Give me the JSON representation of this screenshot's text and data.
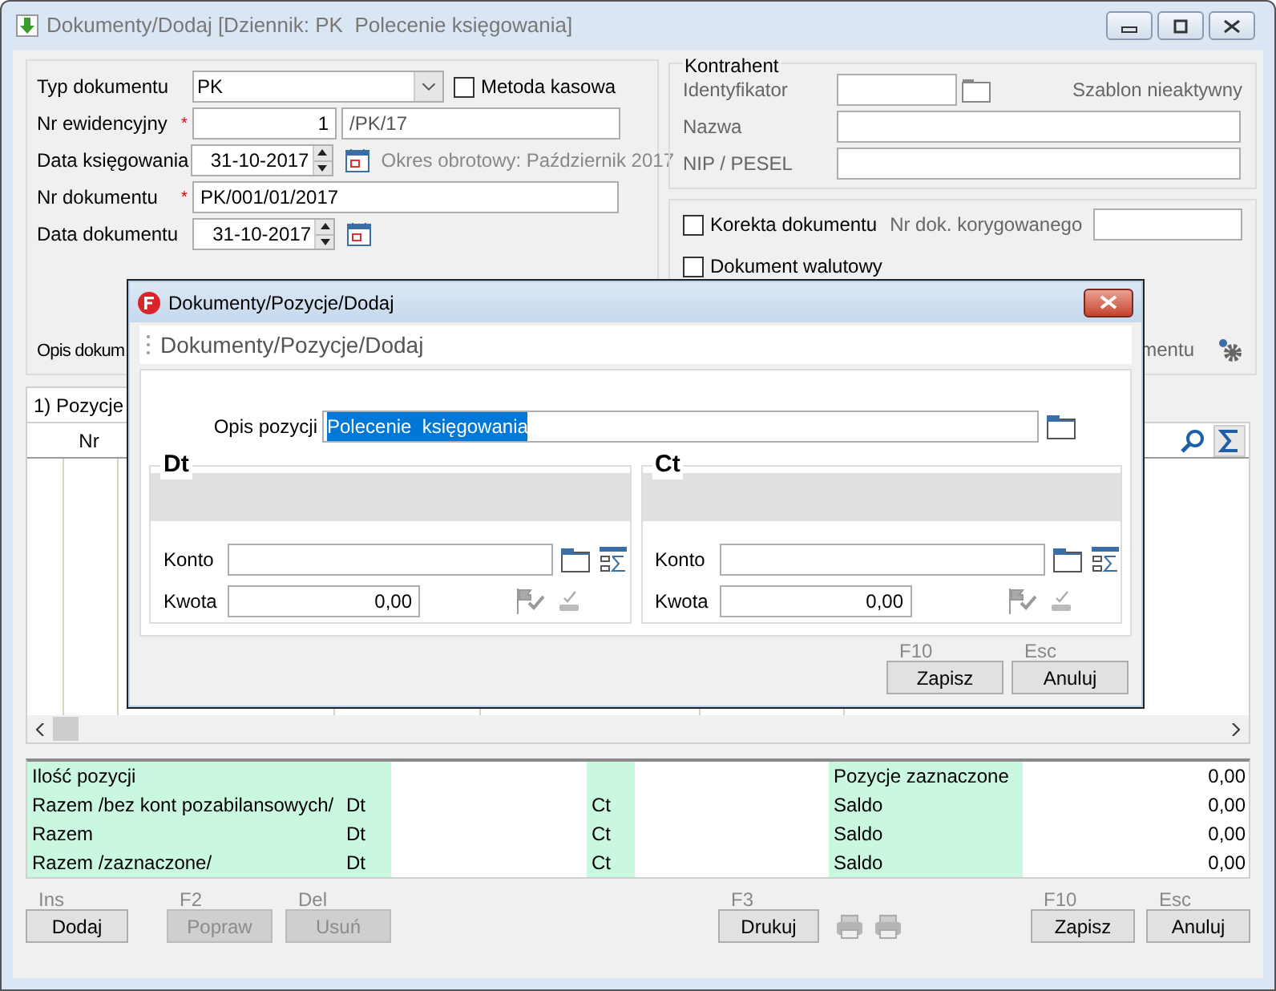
{
  "window": {
    "title": "Dokumenty/Dodaj [Dziennik: PK  Polecenie księgowania]"
  },
  "document": {
    "typ": {
      "label": "Typ dokumentu",
      "value": "PK"
    },
    "metoda_kasowa": {
      "label": "Metoda kasowa",
      "checked": false
    },
    "nr_ewidencyjny": {
      "label": "Nr ewidencyjny",
      "required_mark": "*",
      "number": "1",
      "suffix": "/PK/17"
    },
    "data_ksiegowania": {
      "label": "Data księgowania",
      "value": "31-10-2017",
      "note": "Okres obrotowy: Październik 2017"
    },
    "nr_dokumentu": {
      "label": "Nr dokumentu",
      "required_mark": "*",
      "value": "PK/001/01/2017"
    },
    "data_dokumentu": {
      "label": "Data dokumentu",
      "value": "31-10-2017"
    },
    "opis_label": "Opis dokum"
  },
  "kontrahent": {
    "title": "Kontrahent",
    "identyfikator_label": "Identyfikator",
    "template_status": "Szablon nieaktywny",
    "nazwa_label": "Nazwa",
    "nip_label": "NIP / PESEL"
  },
  "options": {
    "korekta": {
      "label": "Korekta dokumentu",
      "checked": false
    },
    "nr_korygowanego_label": "Nr dok. korygowanego",
    "walutowy": {
      "label": "Dokument walutowy",
      "checked": false
    },
    "partial_label": "mentu"
  },
  "tabs": [
    {
      "label": "1) Pozycje",
      "selected": true
    }
  ],
  "grid": {
    "columns": [
      "Nr"
    ]
  },
  "summary": [
    {
      "label": "Ilość pozycji",
      "right_label": "Pozycje zaznaczone",
      "value": "0,00"
    },
    {
      "label": "Razem /bez kont pozabilansowych/",
      "dt": "Dt",
      "ct": "Ct",
      "right_label": "Saldo",
      "value": "0,00"
    },
    {
      "label": "Razem",
      "dt": "Dt",
      "ct": "Ct",
      "right_label": "Saldo",
      "value": "0,00"
    },
    {
      "label": "Razem /zaznaczone/",
      "dt": "Dt",
      "ct": "Ct",
      "right_label": "Saldo",
      "value": "0,00"
    }
  ],
  "buttons_left": [
    {
      "key": "Ins",
      "label": "Dodaj",
      "disabled": false
    },
    {
      "key": "F2",
      "label": "Popraw",
      "disabled": true
    },
    {
      "key": "Del",
      "label": "Usuń",
      "disabled": true
    }
  ],
  "print_button": {
    "key": "F3",
    "label": "Drukuj",
    "disabled": false
  },
  "buttons_right": [
    {
      "key": "F10",
      "label": "Zapisz",
      "disabled": false
    },
    {
      "key": "Esc",
      "label": "Anuluj",
      "disabled": false
    }
  ],
  "dialog": {
    "title": "Dokumenty/Pozycje/Dodaj",
    "heading": "Dokumenty/Pozycje/Dodaj",
    "opis_label": "Opis pozycji",
    "opis_value": "Polecenie  księgowania",
    "opis_text_selected": true,
    "sides": [
      {
        "title": "Dt",
        "konto_label": "Konto",
        "kwota_label": "Kwota",
        "kwota": "0,00"
      },
      {
        "title": "Ct",
        "konto_label": "Konto",
        "kwota_label": "Kwota",
        "kwota": "0,00"
      }
    ],
    "buttons": [
      {
        "key": "F10",
        "label": "Zapisz"
      },
      {
        "key": "Esc",
        "label": "Anuluj"
      }
    ]
  }
}
